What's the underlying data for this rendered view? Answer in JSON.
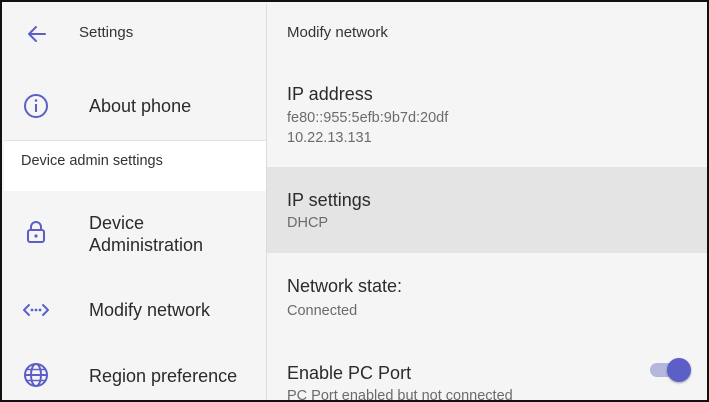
{
  "colors": {
    "accent": "#5b5fc7",
    "selected_row": "#e4e4e4",
    "background": "#f5f5f5"
  },
  "sidebar": {
    "title": "Settings",
    "about_phone": "About phone",
    "section_header": "Device admin settings",
    "items": [
      {
        "label": "Device Administration",
        "icon": "lock-icon"
      },
      {
        "label": "Modify network",
        "icon": "code-dots-icon"
      },
      {
        "label": "Region preference",
        "icon": "globe-icon"
      }
    ]
  },
  "main": {
    "header": "Modify network",
    "ip_address": {
      "title": "IP address",
      "ipv6": "fe80::955:5efb:9b7d:20df",
      "ipv4": "10.22.13.131"
    },
    "ip_settings": {
      "title": "IP settings",
      "value": "DHCP"
    },
    "network_state": {
      "title": "Network state:",
      "value": "Connected"
    },
    "pc_port": {
      "title": "Enable PC Port",
      "value": "PC Port enabled but not connected",
      "enabled": true
    }
  }
}
